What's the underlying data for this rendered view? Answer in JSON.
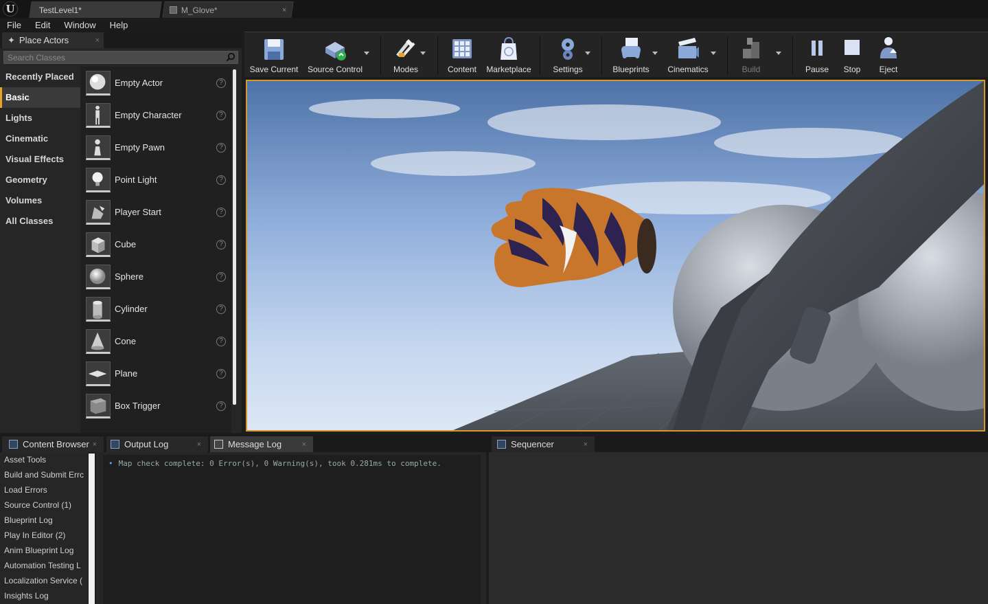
{
  "titlebar": {
    "logo": "U",
    "tabs": [
      {
        "label": "TestLevel1*"
      },
      {
        "label": "M_Glove*"
      }
    ],
    "close_glyph": "×"
  },
  "menu": [
    "File",
    "Edit",
    "Window",
    "Help"
  ],
  "place_actors": {
    "tab_label": "Place Actors",
    "search_placeholder": "Search Classes",
    "categories": [
      "Recently Placed",
      "Basic",
      "Lights",
      "Cinematic",
      "Visual Effects",
      "Geometry",
      "Volumes",
      "All Classes"
    ],
    "selected_category": "Basic",
    "actors": [
      "Empty Actor",
      "Empty Character",
      "Empty Pawn",
      "Point Light",
      "Player Start",
      "Cube",
      "Sphere",
      "Cylinder",
      "Cone",
      "Plane",
      "Box Trigger"
    ],
    "help_glyph": "?"
  },
  "toolbar": {
    "buttons": [
      {
        "label": "Save Current",
        "icon": "floppy-icon"
      },
      {
        "label": "Source Control",
        "icon": "source-control-icon"
      },
      {
        "label": "Modes",
        "icon": "tools-icon"
      },
      {
        "label": "Content",
        "icon": "content-grid-icon"
      },
      {
        "label": "Marketplace",
        "icon": "marketplace-bag-icon"
      },
      {
        "label": "Settings",
        "icon": "gear-icon"
      },
      {
        "label": "Blueprints",
        "icon": "gamepad-icon"
      },
      {
        "label": "Cinematics",
        "icon": "clapper-icon"
      },
      {
        "label": "Build",
        "icon": "build-blocks-icon"
      },
      {
        "label": "Pause",
        "icon": "pause-icon"
      },
      {
        "label": "Stop",
        "icon": "stop-icon"
      },
      {
        "label": "Eject",
        "icon": "eject-person-icon"
      }
    ]
  },
  "bottom": {
    "tabs": [
      {
        "label": "Content Browser"
      },
      {
        "label": "Output Log"
      },
      {
        "label": "Message Log"
      },
      {
        "label": "Sequencer"
      }
    ],
    "log_categories": [
      "Asset Tools",
      "Build and Submit Errc",
      "Load Errors",
      "Source Control (1)",
      "Blueprint Log",
      "Play In Editor (2)",
      "Anim Blueprint Log",
      "Automation Testing L",
      "Localization Service (",
      "Insights Log"
    ],
    "log_message": "Map check complete: 0 Error(s), 0 Warning(s), took 0.281ms to complete.",
    "bullet": "•"
  },
  "colors": {
    "accent": "#e6a325",
    "viewport_border": "#d59a2a",
    "sky_top": "#4e73a8",
    "glove_orange": "#c8762c",
    "glove_purple": "#2e2250"
  }
}
